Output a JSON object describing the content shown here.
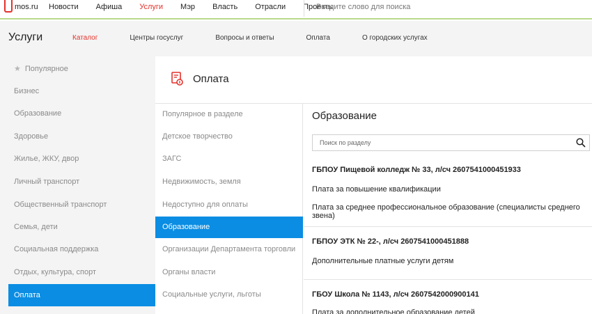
{
  "topbar": {
    "logo": "mos.ru",
    "nav": [
      "Новости",
      "Афиша",
      "Услуги",
      "Мэр",
      "Власть",
      "Отрасли",
      "Проекты"
    ],
    "active_index": 2,
    "search_placeholder": "Введите слово для поиска"
  },
  "section": {
    "title": "Услуги",
    "nav": [
      "Каталог",
      "Центры госуслуг",
      "Вопросы и ответы",
      "Оплата",
      "О городских услугах"
    ],
    "active_index": 0
  },
  "sidebar": {
    "items": [
      "Популярное",
      "Бизнес",
      "Образование",
      "Здоровье",
      "Жилье, ЖКУ, двор",
      "Личный транспорт",
      "Общественный транспорт",
      "Семья, дети",
      "Социальная поддержка",
      "Отдых, культура, спорт",
      "Оплата"
    ],
    "active_index": 10
  },
  "mid": {
    "title": "Оплата",
    "icon": "payment-icon",
    "items": [
      "Популярное в разделе",
      "Детское творчество",
      "ЗАГС",
      "Недвижимость, земля",
      "Недоступно для оплаты",
      "Образование",
      "Организации Департамента торговли",
      "Органы власти",
      "Социальные услуги, льготы"
    ],
    "active_index": 5
  },
  "content": {
    "title": "Образование",
    "search_placeholder": "Поиск по разделу",
    "orgs": [
      {
        "name": "ГБПОУ Пищевой колледж № 33, л/сч 2607541000451933",
        "services": [
          "Плата за повышение квалификации",
          "Плата за среднее профессиональное образование (специалисты среднего звена)"
        ]
      },
      {
        "name": "ГБПОУ ЭТК № 22-, л/сч 2607541000451888",
        "services": [
          "Дополнительные платные услуги детям"
        ]
      },
      {
        "name": "ГБОУ Школа № 1143, л/сч 2607542000900141",
        "services": [
          "Плата за дополнительное образование детей"
        ]
      }
    ]
  },
  "colors": {
    "accent_red": "#e4322b",
    "active_blue": "#0a8de3",
    "green_rule": "#b8d98c"
  }
}
